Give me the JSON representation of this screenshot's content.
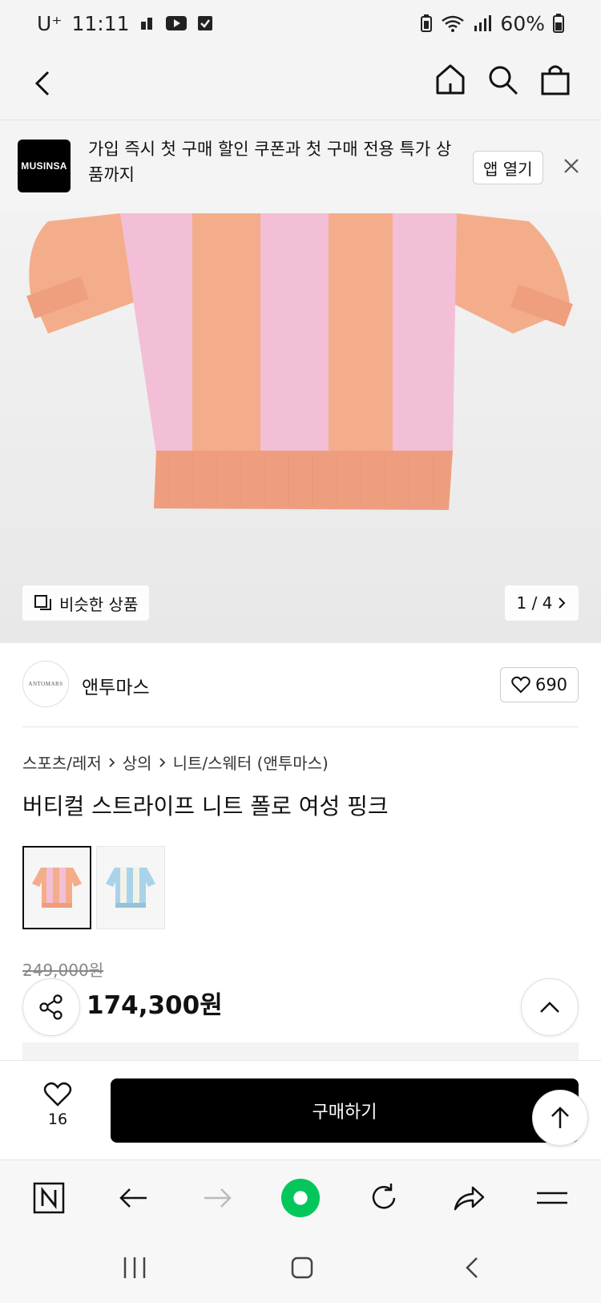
{
  "status_bar": {
    "carrier": "U⁺",
    "time": "11:11",
    "battery": "60%"
  },
  "banner": {
    "logo_text": "MUSINSA",
    "message": "가입 즉시 첫 구매 할인 쿠폰과 첫 구매 전용 특가 상품까지",
    "open_app_label": "앱 열기"
  },
  "gallery": {
    "similar_label": "비슷한 상품",
    "pager": "1 / 4",
    "stripe_colors": [
      "#f3bfd6",
      "#f4ad8a"
    ]
  },
  "brand": {
    "avatar_text": "ANTOMARS",
    "name": "앤투마스",
    "like_count": "690"
  },
  "breadcrumb": [
    "스포츠/레저",
    "상의",
    "니트/스웨터 (앤투마스)"
  ],
  "product": {
    "title": "버티컬 스트라이프 니트 폴로 여성 핑크",
    "color_options": [
      "pink",
      "blue"
    ],
    "original_price": "249,000원",
    "sale_price": "174,300원"
  },
  "buy_bar": {
    "wish_count": "16",
    "buy_label": "구매하기"
  },
  "browser_toolbar": [
    "naver-n-icon",
    "back-arrow-icon",
    "forward-arrow-icon",
    "green-dot-icon",
    "refresh-icon",
    "share-arrow-icon",
    "menu-icon"
  ],
  "colors": {
    "accent_green": "#03c75a",
    "buy_button": "#000000"
  }
}
